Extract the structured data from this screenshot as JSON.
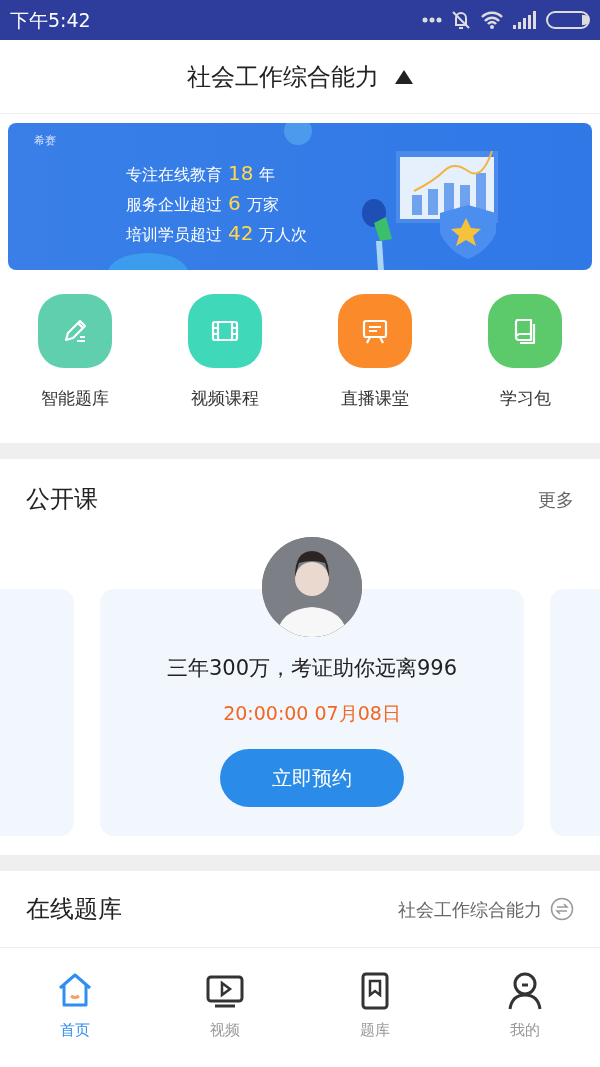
{
  "status_bar": {
    "time": "下午5:42"
  },
  "header": {
    "title": "社会工作综合能力",
    "expanded": true
  },
  "banner": {
    "brand": "希赛",
    "lines": [
      {
        "text": "专注在线教育",
        "number": "18",
        "unit": "年"
      },
      {
        "text": "服务企业超过",
        "number": "6",
        "unit": "万家"
      },
      {
        "text": "培训学员超过",
        "number": "42",
        "unit": "万人次"
      }
    ]
  },
  "shortcuts": [
    {
      "label": "智能题库",
      "kind": "pencil",
      "color": "#5fcfae"
    },
    {
      "label": "视频课程",
      "kind": "film",
      "color": "#3fd8b8"
    },
    {
      "label": "直播课堂",
      "kind": "board",
      "color": "#fb8a2a"
    },
    {
      "label": "学习包",
      "kind": "book",
      "color": "#5cc96a"
    }
  ],
  "open_course": {
    "title": "公开课",
    "more": "更多",
    "course": {
      "title": "三年300万，考证助你远离996",
      "time": "20:00:00  07月08日",
      "button": "立即预约"
    }
  },
  "question_bank": {
    "title": "在线题库",
    "subject": "社会工作综合能力"
  },
  "tabs": [
    {
      "label": "首页",
      "kind": "home",
      "selected": true
    },
    {
      "label": "视频",
      "kind": "video",
      "selected": false
    },
    {
      "label": "题库",
      "kind": "bank",
      "selected": false
    },
    {
      "label": "我的",
      "kind": "me",
      "selected": false
    }
  ]
}
